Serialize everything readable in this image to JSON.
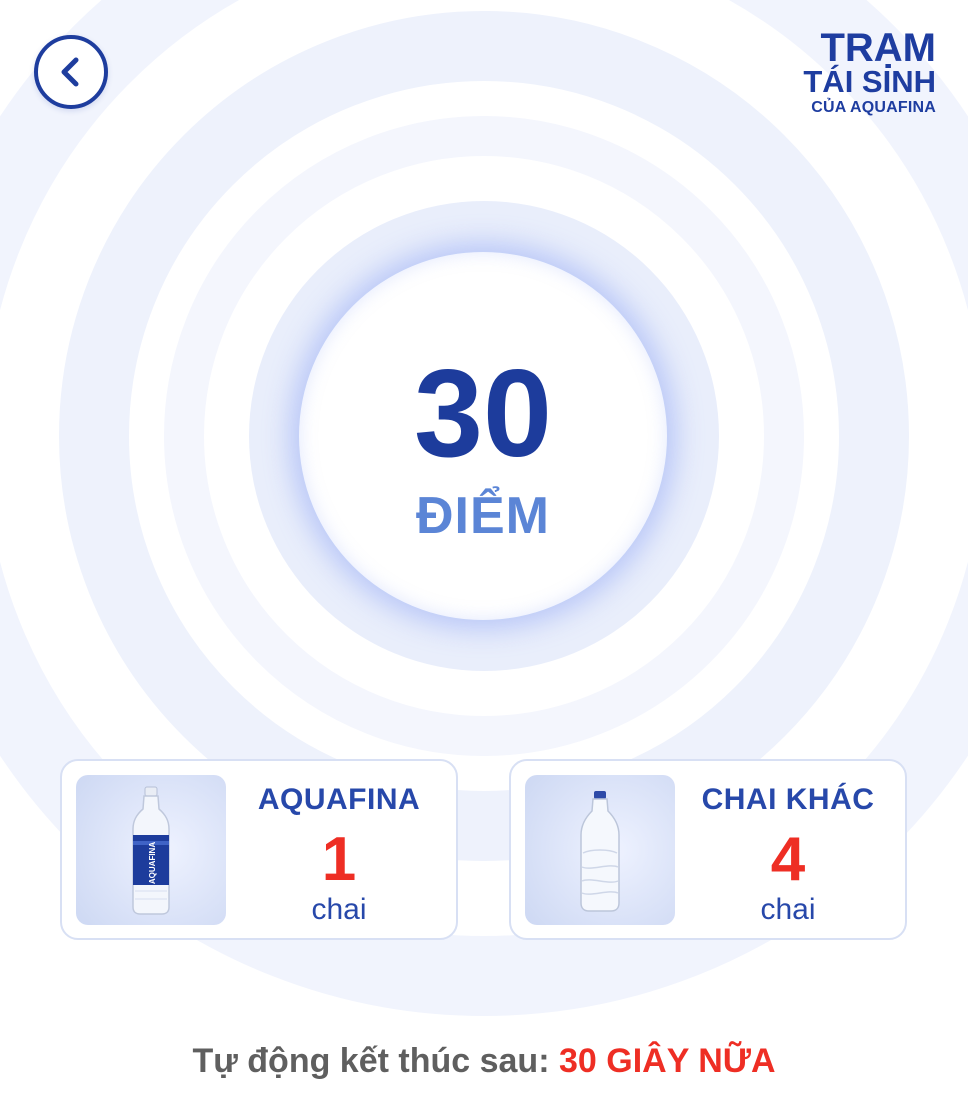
{
  "header": {
    "logo": {
      "line1": "TRẠM",
      "line2": "TÁI SINH",
      "line3": "CỦA AQUAFINA"
    }
  },
  "score": {
    "value": "30",
    "unit": "ĐIỂM"
  },
  "bottles": [
    {
      "title": "AQUAFINA",
      "count": "1",
      "unit": "chai",
      "image": "aquafina-bottle"
    },
    {
      "title": "CHAI KHÁC",
      "count": "4",
      "unit": "chai",
      "image": "clear-plastic-bottle"
    }
  ],
  "footer": {
    "label": "Tự động kết thúc sau:",
    "countdown": "30 GIÂY NỮA"
  },
  "icons": {
    "back": "chevron-left-icon"
  },
  "colors": {
    "brand_blue": "#1e3d9e",
    "accent_red": "#ee2e24",
    "score_unit": "#5b85d6"
  }
}
